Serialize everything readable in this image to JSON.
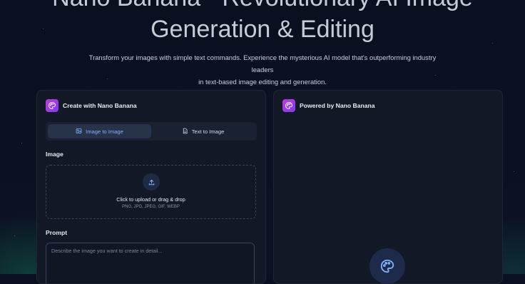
{
  "hero": {
    "title_line1": "Nano Banana - Revolutionary AI Image",
    "title_line2": "Generation & Editing",
    "subtitle_line1": "Transform your images with simple text commands. Experience the mysterious AI model that's outperforming industry leaders",
    "subtitle_line2": "in text-based image editing and generation."
  },
  "create_card": {
    "title": "Create with Nano Banana",
    "icon": "palette-icon",
    "tabs": [
      {
        "label": "Image to Image",
        "icon": "image-icon",
        "active": true
      },
      {
        "label": "Text to Image",
        "icon": "document-icon",
        "active": false
      }
    ],
    "image_label": "Image",
    "upload": {
      "icon": "upload-icon",
      "main_text": "Click to upload or drag & drop",
      "formats": "PNG, JPG, JPEG, GIF, WEBP"
    },
    "prompt_label": "Prompt",
    "prompt_value": "",
    "prompt_placeholder": "Describe the image you want to create in detail..."
  },
  "output_card": {
    "title": "Powered by Nano Banana",
    "icon": "palette-icon",
    "placeholder_icon": "palette-icon"
  },
  "colors": {
    "background": "#0b1020",
    "card": "#121826",
    "accent_blue": "#7fb1ff",
    "logo_gradient_start": "#c13ad8",
    "logo_gradient_end": "#7d3cf0"
  }
}
